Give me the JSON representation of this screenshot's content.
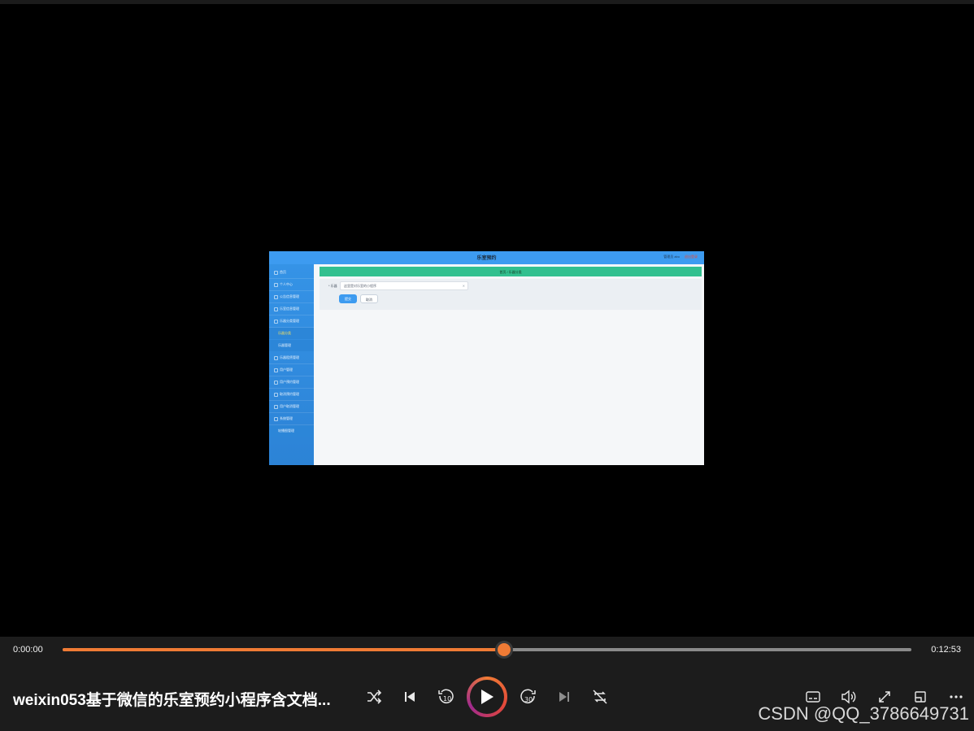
{
  "app": {
    "title": "乐室预约",
    "user": "管理员 abo",
    "logout": "退出登录",
    "sidebar": [
      {
        "label": "首页"
      },
      {
        "label": "个人中心"
      },
      {
        "label": "公告信息管理"
      },
      {
        "label": "乐室信息管理"
      },
      {
        "label": "乐器分类管理"
      },
      {
        "label": "乐器分类",
        "sub": true,
        "active": true
      },
      {
        "label": "乐器管理",
        "sub": true
      },
      {
        "label": "乐器租赁管理"
      },
      {
        "label": "用户管理"
      },
      {
        "label": "用户预约管理"
      },
      {
        "label": "取消预约管理"
      },
      {
        "label": "用户取消管理"
      },
      {
        "label": "系统管理"
      },
      {
        "label": "轮播图管理",
        "sub": true
      }
    ],
    "banner": "首页 / 乐器分类",
    "form": {
      "field_label": "* 乐器",
      "field_value": "这里是对乐室的小程序",
      "submit_label": "提交",
      "cancel_label": "取消"
    }
  },
  "player": {
    "current_time": "0:00:00",
    "duration": "0:12:53",
    "progress_percent": 52,
    "progress_color": "#f07b35",
    "title": "weixin053基于微信的乐室预约小程序含文档...",
    "watermark": "CSDN @QQ_3786649731",
    "buttons": [
      "shuffle-icon",
      "previous-icon",
      "rewind-10-icon",
      "play-icon",
      "forward-30-icon",
      "next-icon",
      "repeat-icon",
      "subtitles-icon",
      "volume-icon",
      "fullscreen-icon",
      "mini-player-icon",
      "more-icon"
    ]
  }
}
